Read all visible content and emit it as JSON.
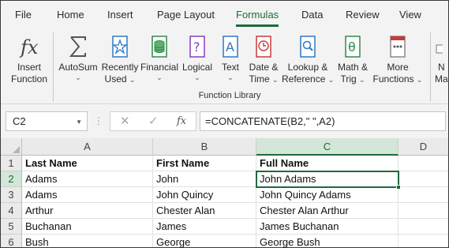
{
  "tabs": [
    "File",
    "Home",
    "Insert",
    "Page Layout",
    "Formulas",
    "Data",
    "Review",
    "View"
  ],
  "ribbon": {
    "insert_function": {
      "line1": "Insert",
      "line2": "Function",
      "icon": "fx-icon"
    },
    "buttons": [
      {
        "line1": "AutoSum",
        "line2": "",
        "icon": "sigma-icon"
      },
      {
        "line1": "Recently",
        "line2": "Used",
        "icon": "star-book-icon"
      },
      {
        "line1": "Financial",
        "line2": "",
        "icon": "financial-icon"
      },
      {
        "line1": "Logical",
        "line2": "",
        "icon": "question-book-icon"
      },
      {
        "line1": "Text",
        "line2": "",
        "icon": "text-book-icon"
      },
      {
        "line1": "Date &",
        "line2": "Time",
        "icon": "clock-book-icon"
      },
      {
        "line1": "Lookup &",
        "line2": "Reference",
        "icon": "magnifier-book-icon"
      },
      {
        "line1": "Math &",
        "line2": "Trig",
        "icon": "theta-book-icon"
      },
      {
        "line1": "More",
        "line2": "Functions",
        "icon": "more-book-icon"
      }
    ],
    "partial": {
      "line1": "N",
      "line2": "Ma"
    },
    "group_label": "Function Library"
  },
  "formula_bar": {
    "name_box": "C2",
    "cancel_glyph": "✕",
    "enter_glyph": "✓",
    "fx_glyph": "fx",
    "formula": "=CONCATENATE(B2,\" \",A2)"
  },
  "columns": [
    "A",
    "B",
    "C",
    "D"
  ],
  "rows": [
    "1",
    "2",
    "3",
    "4",
    "5",
    "6"
  ],
  "cells": [
    [
      "Last Name",
      "First Name",
      "Full Name",
      ""
    ],
    [
      "Adams",
      "John",
      "John  Adams",
      ""
    ],
    [
      "Adams",
      "John Quincy",
      "John Quincy  Adams",
      ""
    ],
    [
      "Arthur",
      "Chester Alan",
      "Chester Alan  Arthur",
      ""
    ],
    [
      "Buchanan",
      "James",
      "James  Buchanan",
      ""
    ],
    [
      "Bush",
      "George",
      "George  Bush",
      ""
    ]
  ],
  "colors": {
    "accent": "#1d6b3a",
    "header_bg": "#eaeaea",
    "selected_header_bg": "#d3e6d7"
  }
}
